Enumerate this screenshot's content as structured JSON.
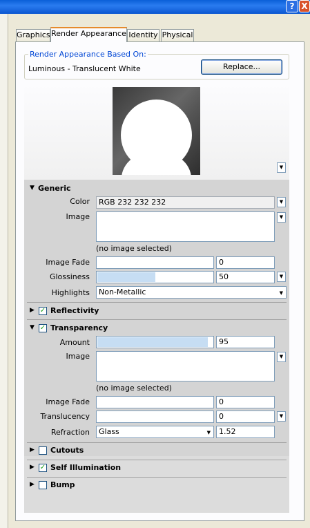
{
  "window": {
    "help_glyph": "?",
    "close_glyph": "X"
  },
  "tabs": [
    {
      "label": "Graphics",
      "active": false
    },
    {
      "label": "Render Appearance",
      "active": true
    },
    {
      "label": "Identity",
      "active": false
    },
    {
      "label": "Physical",
      "active": false
    }
  ],
  "appearance": {
    "group_title": "Render Appearance Based On:",
    "material_name": "Luminous - Translucent White",
    "replace_label": "Replace..."
  },
  "generic": {
    "title": "Generic",
    "color_label": "Color",
    "color_value": "RGB 232 232 232",
    "image_label": "Image",
    "image_status": "(no image selected)",
    "image_fade_label": "Image Fade",
    "image_fade_value": "0",
    "glossiness_label": "Glossiness",
    "glossiness_value": "50",
    "highlights_label": "Highlights",
    "highlights_value": "Non-Metallic"
  },
  "reflectivity": {
    "title": "Reflectivity",
    "checked": true
  },
  "transparency": {
    "title": "Transparency",
    "checked": true,
    "amount_label": "Amount",
    "amount_value": "95",
    "image_label": "Image",
    "image_status": "(no image selected)",
    "image_fade_label": "Image Fade",
    "image_fade_value": "0",
    "translucency_label": "Translucency",
    "translucency_value": "0",
    "refraction_label": "Refraction",
    "refraction_select": "Glass",
    "refraction_value": "1.52"
  },
  "cutouts": {
    "title": "Cutouts",
    "checked": false
  },
  "self_illumination": {
    "title": "Self Illumination",
    "checked": true
  },
  "bump": {
    "title": "Bump",
    "checked": false
  },
  "glyphs": {
    "expanded": "▼",
    "collapsed": "▶",
    "dropdown": "▼",
    "check": "✓"
  }
}
